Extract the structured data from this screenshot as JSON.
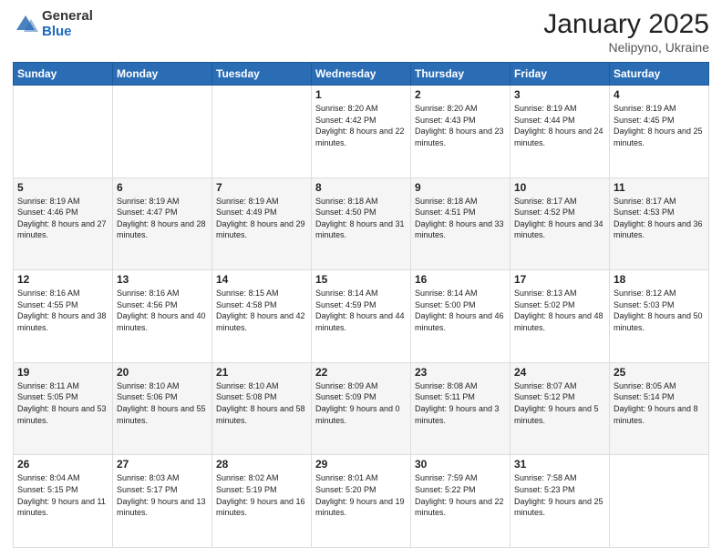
{
  "logo": {
    "general": "General",
    "blue": "Blue"
  },
  "title": "January 2025",
  "location": "Nelipyno, Ukraine",
  "days_header": [
    "Sunday",
    "Monday",
    "Tuesday",
    "Wednesday",
    "Thursday",
    "Friday",
    "Saturday"
  ],
  "weeks": [
    [
      {
        "day": "",
        "sunrise": "",
        "sunset": "",
        "daylight": ""
      },
      {
        "day": "",
        "sunrise": "",
        "sunset": "",
        "daylight": ""
      },
      {
        "day": "",
        "sunrise": "",
        "sunset": "",
        "daylight": ""
      },
      {
        "day": "1",
        "sunrise": "Sunrise: 8:20 AM",
        "sunset": "Sunset: 4:42 PM",
        "daylight": "Daylight: 8 hours and 22 minutes."
      },
      {
        "day": "2",
        "sunrise": "Sunrise: 8:20 AM",
        "sunset": "Sunset: 4:43 PM",
        "daylight": "Daylight: 8 hours and 23 minutes."
      },
      {
        "day": "3",
        "sunrise": "Sunrise: 8:19 AM",
        "sunset": "Sunset: 4:44 PM",
        "daylight": "Daylight: 8 hours and 24 minutes."
      },
      {
        "day": "4",
        "sunrise": "Sunrise: 8:19 AM",
        "sunset": "Sunset: 4:45 PM",
        "daylight": "Daylight: 8 hours and 25 minutes."
      }
    ],
    [
      {
        "day": "5",
        "sunrise": "Sunrise: 8:19 AM",
        "sunset": "Sunset: 4:46 PM",
        "daylight": "Daylight: 8 hours and 27 minutes."
      },
      {
        "day": "6",
        "sunrise": "Sunrise: 8:19 AM",
        "sunset": "Sunset: 4:47 PM",
        "daylight": "Daylight: 8 hours and 28 minutes."
      },
      {
        "day": "7",
        "sunrise": "Sunrise: 8:19 AM",
        "sunset": "Sunset: 4:49 PM",
        "daylight": "Daylight: 8 hours and 29 minutes."
      },
      {
        "day": "8",
        "sunrise": "Sunrise: 8:18 AM",
        "sunset": "Sunset: 4:50 PM",
        "daylight": "Daylight: 8 hours and 31 minutes."
      },
      {
        "day": "9",
        "sunrise": "Sunrise: 8:18 AM",
        "sunset": "Sunset: 4:51 PM",
        "daylight": "Daylight: 8 hours and 33 minutes."
      },
      {
        "day": "10",
        "sunrise": "Sunrise: 8:17 AM",
        "sunset": "Sunset: 4:52 PM",
        "daylight": "Daylight: 8 hours and 34 minutes."
      },
      {
        "day": "11",
        "sunrise": "Sunrise: 8:17 AM",
        "sunset": "Sunset: 4:53 PM",
        "daylight": "Daylight: 8 hours and 36 minutes."
      }
    ],
    [
      {
        "day": "12",
        "sunrise": "Sunrise: 8:16 AM",
        "sunset": "Sunset: 4:55 PM",
        "daylight": "Daylight: 8 hours and 38 minutes."
      },
      {
        "day": "13",
        "sunrise": "Sunrise: 8:16 AM",
        "sunset": "Sunset: 4:56 PM",
        "daylight": "Daylight: 8 hours and 40 minutes."
      },
      {
        "day": "14",
        "sunrise": "Sunrise: 8:15 AM",
        "sunset": "Sunset: 4:58 PM",
        "daylight": "Daylight: 8 hours and 42 minutes."
      },
      {
        "day": "15",
        "sunrise": "Sunrise: 8:14 AM",
        "sunset": "Sunset: 4:59 PM",
        "daylight": "Daylight: 8 hours and 44 minutes."
      },
      {
        "day": "16",
        "sunrise": "Sunrise: 8:14 AM",
        "sunset": "Sunset: 5:00 PM",
        "daylight": "Daylight: 8 hours and 46 minutes."
      },
      {
        "day": "17",
        "sunrise": "Sunrise: 8:13 AM",
        "sunset": "Sunset: 5:02 PM",
        "daylight": "Daylight: 8 hours and 48 minutes."
      },
      {
        "day": "18",
        "sunrise": "Sunrise: 8:12 AM",
        "sunset": "Sunset: 5:03 PM",
        "daylight": "Daylight: 8 hours and 50 minutes."
      }
    ],
    [
      {
        "day": "19",
        "sunrise": "Sunrise: 8:11 AM",
        "sunset": "Sunset: 5:05 PM",
        "daylight": "Daylight: 8 hours and 53 minutes."
      },
      {
        "day": "20",
        "sunrise": "Sunrise: 8:10 AM",
        "sunset": "Sunset: 5:06 PM",
        "daylight": "Daylight: 8 hours and 55 minutes."
      },
      {
        "day": "21",
        "sunrise": "Sunrise: 8:10 AM",
        "sunset": "Sunset: 5:08 PM",
        "daylight": "Daylight: 8 hours and 58 minutes."
      },
      {
        "day": "22",
        "sunrise": "Sunrise: 8:09 AM",
        "sunset": "Sunset: 5:09 PM",
        "daylight": "Daylight: 9 hours and 0 minutes."
      },
      {
        "day": "23",
        "sunrise": "Sunrise: 8:08 AM",
        "sunset": "Sunset: 5:11 PM",
        "daylight": "Daylight: 9 hours and 3 minutes."
      },
      {
        "day": "24",
        "sunrise": "Sunrise: 8:07 AM",
        "sunset": "Sunset: 5:12 PM",
        "daylight": "Daylight: 9 hours and 5 minutes."
      },
      {
        "day": "25",
        "sunrise": "Sunrise: 8:05 AM",
        "sunset": "Sunset: 5:14 PM",
        "daylight": "Daylight: 9 hours and 8 minutes."
      }
    ],
    [
      {
        "day": "26",
        "sunrise": "Sunrise: 8:04 AM",
        "sunset": "Sunset: 5:15 PM",
        "daylight": "Daylight: 9 hours and 11 minutes."
      },
      {
        "day": "27",
        "sunrise": "Sunrise: 8:03 AM",
        "sunset": "Sunset: 5:17 PM",
        "daylight": "Daylight: 9 hours and 13 minutes."
      },
      {
        "day": "28",
        "sunrise": "Sunrise: 8:02 AM",
        "sunset": "Sunset: 5:19 PM",
        "daylight": "Daylight: 9 hours and 16 minutes."
      },
      {
        "day": "29",
        "sunrise": "Sunrise: 8:01 AM",
        "sunset": "Sunset: 5:20 PM",
        "daylight": "Daylight: 9 hours and 19 minutes."
      },
      {
        "day": "30",
        "sunrise": "Sunrise: 7:59 AM",
        "sunset": "Sunset: 5:22 PM",
        "daylight": "Daylight: 9 hours and 22 minutes."
      },
      {
        "day": "31",
        "sunrise": "Sunrise: 7:58 AM",
        "sunset": "Sunset: 5:23 PM",
        "daylight": "Daylight: 9 hours and 25 minutes."
      },
      {
        "day": "",
        "sunrise": "",
        "sunset": "",
        "daylight": ""
      }
    ]
  ]
}
